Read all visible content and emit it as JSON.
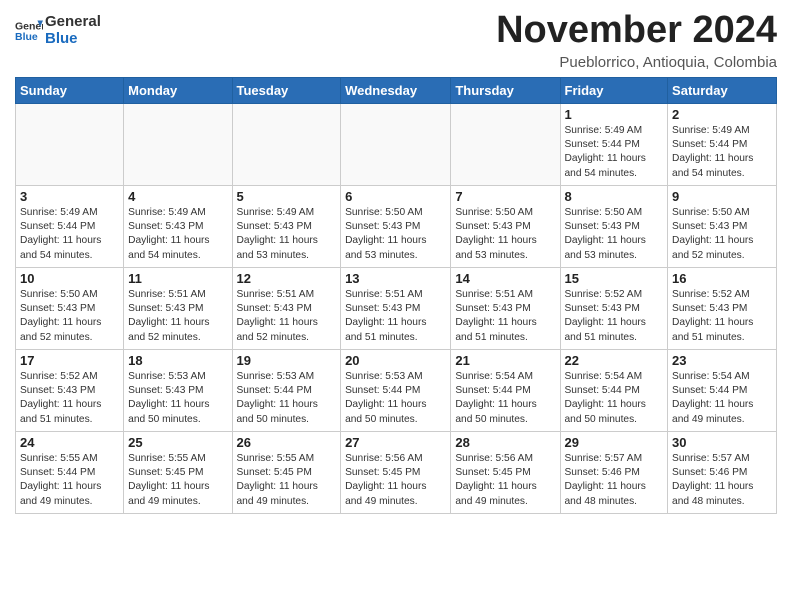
{
  "header": {
    "logo_line1": "General",
    "logo_line2": "Blue",
    "month": "November 2024",
    "location": "Pueblorrico, Antioquia, Colombia"
  },
  "weekdays": [
    "Sunday",
    "Monday",
    "Tuesday",
    "Wednesday",
    "Thursday",
    "Friday",
    "Saturday"
  ],
  "weeks": [
    [
      {
        "day": "",
        "info": ""
      },
      {
        "day": "",
        "info": ""
      },
      {
        "day": "",
        "info": ""
      },
      {
        "day": "",
        "info": ""
      },
      {
        "day": "",
        "info": ""
      },
      {
        "day": "1",
        "info": "Sunrise: 5:49 AM\nSunset: 5:44 PM\nDaylight: 11 hours\nand 54 minutes."
      },
      {
        "day": "2",
        "info": "Sunrise: 5:49 AM\nSunset: 5:44 PM\nDaylight: 11 hours\nand 54 minutes."
      }
    ],
    [
      {
        "day": "3",
        "info": "Sunrise: 5:49 AM\nSunset: 5:44 PM\nDaylight: 11 hours\nand 54 minutes."
      },
      {
        "day": "4",
        "info": "Sunrise: 5:49 AM\nSunset: 5:43 PM\nDaylight: 11 hours\nand 54 minutes."
      },
      {
        "day": "5",
        "info": "Sunrise: 5:49 AM\nSunset: 5:43 PM\nDaylight: 11 hours\nand 53 minutes."
      },
      {
        "day": "6",
        "info": "Sunrise: 5:50 AM\nSunset: 5:43 PM\nDaylight: 11 hours\nand 53 minutes."
      },
      {
        "day": "7",
        "info": "Sunrise: 5:50 AM\nSunset: 5:43 PM\nDaylight: 11 hours\nand 53 minutes."
      },
      {
        "day": "8",
        "info": "Sunrise: 5:50 AM\nSunset: 5:43 PM\nDaylight: 11 hours\nand 53 minutes."
      },
      {
        "day": "9",
        "info": "Sunrise: 5:50 AM\nSunset: 5:43 PM\nDaylight: 11 hours\nand 52 minutes."
      }
    ],
    [
      {
        "day": "10",
        "info": "Sunrise: 5:50 AM\nSunset: 5:43 PM\nDaylight: 11 hours\nand 52 minutes."
      },
      {
        "day": "11",
        "info": "Sunrise: 5:51 AM\nSunset: 5:43 PM\nDaylight: 11 hours\nand 52 minutes."
      },
      {
        "day": "12",
        "info": "Sunrise: 5:51 AM\nSunset: 5:43 PM\nDaylight: 11 hours\nand 52 minutes."
      },
      {
        "day": "13",
        "info": "Sunrise: 5:51 AM\nSunset: 5:43 PM\nDaylight: 11 hours\nand 51 minutes."
      },
      {
        "day": "14",
        "info": "Sunrise: 5:51 AM\nSunset: 5:43 PM\nDaylight: 11 hours\nand 51 minutes."
      },
      {
        "day": "15",
        "info": "Sunrise: 5:52 AM\nSunset: 5:43 PM\nDaylight: 11 hours\nand 51 minutes."
      },
      {
        "day": "16",
        "info": "Sunrise: 5:52 AM\nSunset: 5:43 PM\nDaylight: 11 hours\nand 51 minutes."
      }
    ],
    [
      {
        "day": "17",
        "info": "Sunrise: 5:52 AM\nSunset: 5:43 PM\nDaylight: 11 hours\nand 51 minutes."
      },
      {
        "day": "18",
        "info": "Sunrise: 5:53 AM\nSunset: 5:43 PM\nDaylight: 11 hours\nand 50 minutes."
      },
      {
        "day": "19",
        "info": "Sunrise: 5:53 AM\nSunset: 5:44 PM\nDaylight: 11 hours\nand 50 minutes."
      },
      {
        "day": "20",
        "info": "Sunrise: 5:53 AM\nSunset: 5:44 PM\nDaylight: 11 hours\nand 50 minutes."
      },
      {
        "day": "21",
        "info": "Sunrise: 5:54 AM\nSunset: 5:44 PM\nDaylight: 11 hours\nand 50 minutes."
      },
      {
        "day": "22",
        "info": "Sunrise: 5:54 AM\nSunset: 5:44 PM\nDaylight: 11 hours\nand 50 minutes."
      },
      {
        "day": "23",
        "info": "Sunrise: 5:54 AM\nSunset: 5:44 PM\nDaylight: 11 hours\nand 49 minutes."
      }
    ],
    [
      {
        "day": "24",
        "info": "Sunrise: 5:55 AM\nSunset: 5:44 PM\nDaylight: 11 hours\nand 49 minutes."
      },
      {
        "day": "25",
        "info": "Sunrise: 5:55 AM\nSunset: 5:45 PM\nDaylight: 11 hours\nand 49 minutes."
      },
      {
        "day": "26",
        "info": "Sunrise: 5:55 AM\nSunset: 5:45 PM\nDaylight: 11 hours\nand 49 minutes."
      },
      {
        "day": "27",
        "info": "Sunrise: 5:56 AM\nSunset: 5:45 PM\nDaylight: 11 hours\nand 49 minutes."
      },
      {
        "day": "28",
        "info": "Sunrise: 5:56 AM\nSunset: 5:45 PM\nDaylight: 11 hours\nand 49 minutes."
      },
      {
        "day": "29",
        "info": "Sunrise: 5:57 AM\nSunset: 5:46 PM\nDaylight: 11 hours\nand 48 minutes."
      },
      {
        "day": "30",
        "info": "Sunrise: 5:57 AM\nSunset: 5:46 PM\nDaylight: 11 hours\nand 48 minutes."
      }
    ]
  ]
}
